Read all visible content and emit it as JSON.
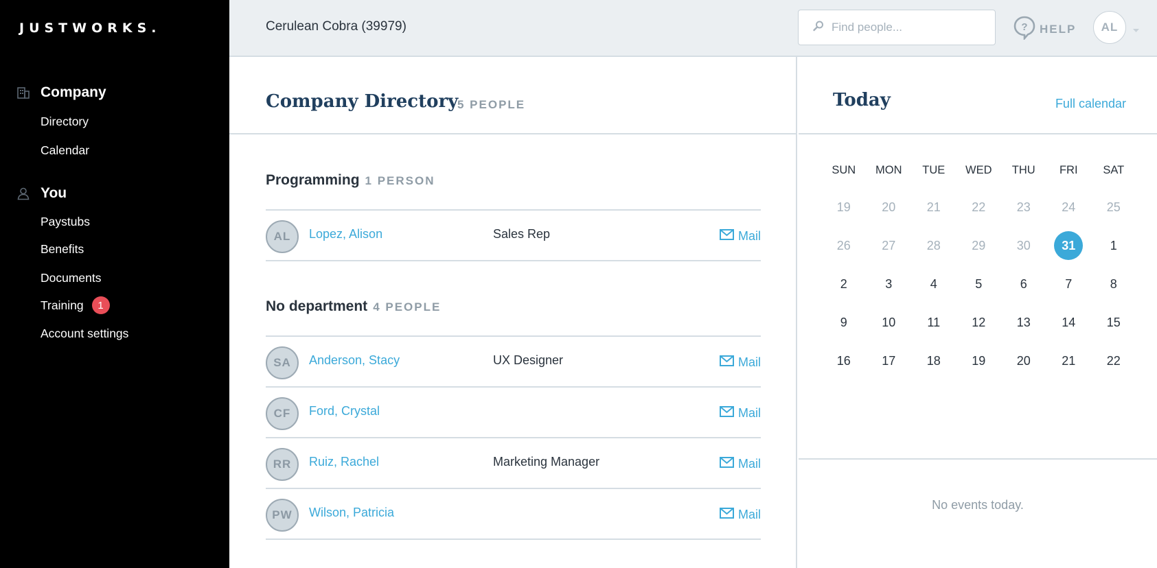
{
  "logo": "JUSTWORKS.",
  "sidebar": {
    "company": {
      "heading": "Company",
      "icon": "building-icon",
      "items": [
        "Directory",
        "Calendar"
      ]
    },
    "you": {
      "heading": "You",
      "icon": "user-icon",
      "items": [
        "Paystubs",
        "Benefits",
        "Documents",
        "Training",
        "Account settings"
      ],
      "training_badge": "1"
    }
  },
  "header": {
    "company_name": "Cerulean Cobra (39979)",
    "search_placeholder": "Find people...",
    "help_label": "HELP",
    "avatar_initials": "AL"
  },
  "directory": {
    "title": "Company Directory",
    "count": "5 PEOPLE",
    "departments": [
      {
        "name": "Programming",
        "count": "1 PERSON",
        "people": [
          {
            "initials": "AL",
            "name": "Lopez, Alison",
            "title": "Sales Rep",
            "mail": "Mail"
          }
        ]
      },
      {
        "name": "No department",
        "count": "4 PEOPLE",
        "people": [
          {
            "initials": "SA",
            "name": "Anderson, Stacy",
            "title": "UX Designer",
            "mail": "Mail"
          },
          {
            "initials": "CF",
            "name": "Ford, Crystal",
            "title": "",
            "mail": "Mail"
          },
          {
            "initials": "RR",
            "name": "Ruiz, Rachel",
            "title": "Marketing Manager",
            "mail": "Mail"
          },
          {
            "initials": "PW",
            "name": "Wilson, Patricia",
            "title": "",
            "mail": "Mail"
          }
        ]
      }
    ]
  },
  "calendar": {
    "title": "Today",
    "full_calendar_link": "Full calendar",
    "weekdays": [
      "SUN",
      "MON",
      "TUE",
      "WED",
      "THU",
      "FRI",
      "SAT"
    ],
    "weeks": [
      [
        "19",
        "20",
        "21",
        "22",
        "23",
        "24",
        "25"
      ],
      [
        "26",
        "27",
        "28",
        "29",
        "30",
        "31",
        "1"
      ],
      [
        "2",
        "3",
        "4",
        "5",
        "6",
        "7",
        "8"
      ],
      [
        "9",
        "10",
        "11",
        "12",
        "13",
        "14",
        "15"
      ],
      [
        "16",
        "17",
        "18",
        "19",
        "20",
        "21",
        "22"
      ]
    ],
    "muted_days": [
      "19",
      "20",
      "21",
      "22",
      "23",
      "24",
      "25",
      "26",
      "27",
      "28",
      "29",
      "30"
    ],
    "today": "31",
    "no_events": "No events today."
  },
  "colors": {
    "accent": "#3ba9d9",
    "heading_navy": "#203f5e",
    "badge_red": "#e94e58",
    "sidebar_bg": "#000000",
    "header_bg": "#ebeff2"
  }
}
